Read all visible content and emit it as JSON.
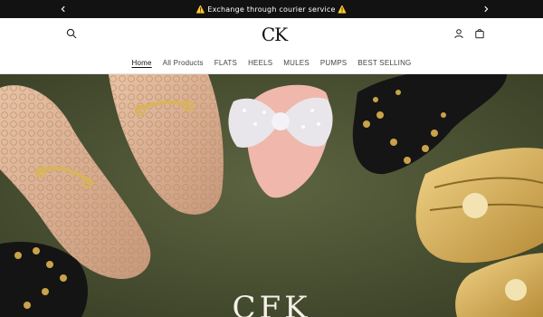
{
  "announcement": {
    "text": "⚠️ Exchange through courier service ⚠️"
  },
  "header": {
    "logo_text": "CK",
    "nav": [
      {
        "label": "Home",
        "active": true
      },
      {
        "label": "All Products"
      },
      {
        "label": "FLATS"
      },
      {
        "label": "HEELS"
      },
      {
        "label": "MULES"
      },
      {
        "label": "PUMPS"
      },
      {
        "label": "BEST SELLING"
      }
    ]
  },
  "hero": {
    "title": "CFK"
  },
  "icons": {
    "prev": "chevron-left-icon",
    "next": "chevron-right-icon",
    "search": "search-icon",
    "account": "user-icon",
    "cart": "cart-icon"
  },
  "colors": {
    "announcement_bg": "#121212",
    "hero_bg": "#4e5533",
    "text_dark": "#111111"
  }
}
